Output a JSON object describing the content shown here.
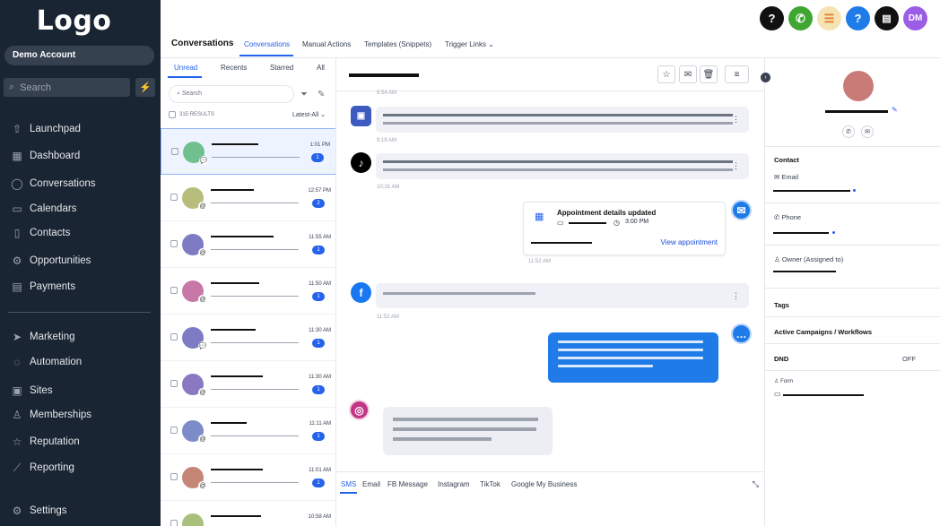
{
  "sidebar": {
    "logo": "Logo",
    "account": "Demo Account",
    "search_placeholder": "Search",
    "nav": [
      {
        "label": "Launchpad",
        "icon": "rocket-icon"
      },
      {
        "label": "Dashboard",
        "icon": "grid-icon"
      },
      {
        "label": "Conversations",
        "icon": "chat-icon"
      },
      {
        "label": "Calendars",
        "icon": "calendar-icon"
      },
      {
        "label": "Contacts",
        "icon": "contact-card-icon"
      },
      {
        "label": "Opportunities",
        "icon": "funnel-icon"
      },
      {
        "label": "Payments",
        "icon": "invoice-icon"
      },
      {
        "label": "Marketing",
        "icon": "send-icon"
      },
      {
        "label": "Automation",
        "icon": "automation-icon"
      },
      {
        "label": "Sites",
        "icon": "sites-icon"
      },
      {
        "label": "Memberships",
        "icon": "badge-icon"
      },
      {
        "label": "Reputation",
        "icon": "star-icon"
      },
      {
        "label": "Reporting",
        "icon": "chart-line-icon"
      },
      {
        "label": "Settings",
        "icon": "gear-icon"
      }
    ]
  },
  "topbar": {
    "icons": [
      {
        "glyph": "?",
        "bg": "#111111",
        "name": "help-icon"
      },
      {
        "glyph": "✆",
        "bg": "#3ea631",
        "name": "phone-icon"
      },
      {
        "glyph": "☰",
        "bg": "#f6e3b4",
        "name": "list-icon"
      },
      {
        "glyph": "?",
        "bg": "#1f7be8",
        "name": "support-icon"
      },
      {
        "glyph": "▤",
        "bg": "#111111",
        "name": "contact-card-icon"
      }
    ],
    "avatar": "DM",
    "avatar_color": "#9b5de5"
  },
  "header": {
    "title": "Conversations",
    "tabs": [
      "Conversations",
      "Manual Actions",
      "Templates (Snippets)",
      "Trigger Links"
    ]
  },
  "list": {
    "tabs": [
      "Unread",
      "Recents",
      "Starred",
      "All"
    ],
    "search_placeholder": "Search",
    "results": "315 RESULTS",
    "sort": "Latest-All",
    "rows": [
      {
        "time": "1:01 PM",
        "count": "1",
        "color": "#6fbf8f",
        "channel": "💬"
      },
      {
        "time": "12:57 PM",
        "count": "2",
        "color": "#b7bd7a",
        "channel": "@"
      },
      {
        "time": "11:55 AM",
        "count": "1",
        "color": "#7d7bc4",
        "channel": "@"
      },
      {
        "time": "11:50 AM",
        "count": "1",
        "color": "#c778a8",
        "channel": "@"
      },
      {
        "time": "11:30 AM",
        "count": "1",
        "color": "#7d7bc4",
        "channel": "💬"
      },
      {
        "time": "11:30 AM",
        "count": "1",
        "color": "#8a78c0",
        "channel": "@"
      },
      {
        "time": "11:11 AM",
        "count": "1",
        "color": "#7b8cc8",
        "channel": "@"
      },
      {
        "time": "11:01 AM",
        "count": "1",
        "color": "#c58577",
        "channel": "@"
      },
      {
        "time": "10:58 AM",
        "count": "",
        "color": "#a9c07c",
        "channel": "@"
      }
    ]
  },
  "conversation": {
    "times": [
      "8:54 AM",
      "9:19 AM",
      "10:15 AM",
      "11:52 AM",
      "11:52 AM"
    ],
    "appointment": {
      "title": "Appointment details updated",
      "time": "3:00 PM",
      "link": "View appointment"
    },
    "compose_tabs": [
      "SMS",
      "Email",
      "FB Message",
      "Instagram",
      "TikTok",
      "Google My Business"
    ]
  },
  "contact": {
    "section": "Contact",
    "email_label": "Email",
    "phone_label": "Phone",
    "owner_label": "Owner (Assigned to)",
    "tags": "Tags",
    "campaigns": "Active Campaigns / Workflows",
    "dnd": "DND",
    "dnd_value": "OFF",
    "form_label": "Form"
  }
}
